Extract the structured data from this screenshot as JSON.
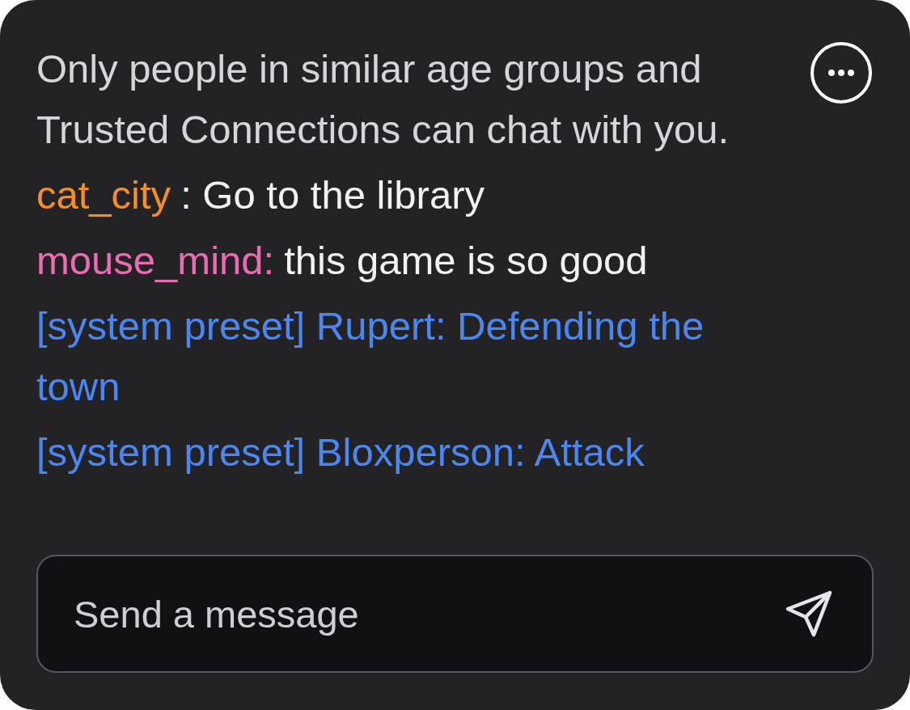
{
  "notice": "Only people in similar age groups and Trusted Connections can chat with you.",
  "messages": [
    {
      "kind": "chat",
      "author": "cat_city",
      "color": "#f5901e",
      "text": ": Go to the library"
    },
    {
      "kind": "chat",
      "author": "mouse_mind:",
      "color": "#ea6cb3",
      "text": "this game is so good"
    },
    {
      "kind": "system",
      "text": "[system preset] Rupert: Defending the town"
    },
    {
      "kind": "system",
      "text": "[system preset] Bloxperson: Attack"
    }
  ],
  "input": {
    "placeholder": "Send a message"
  }
}
